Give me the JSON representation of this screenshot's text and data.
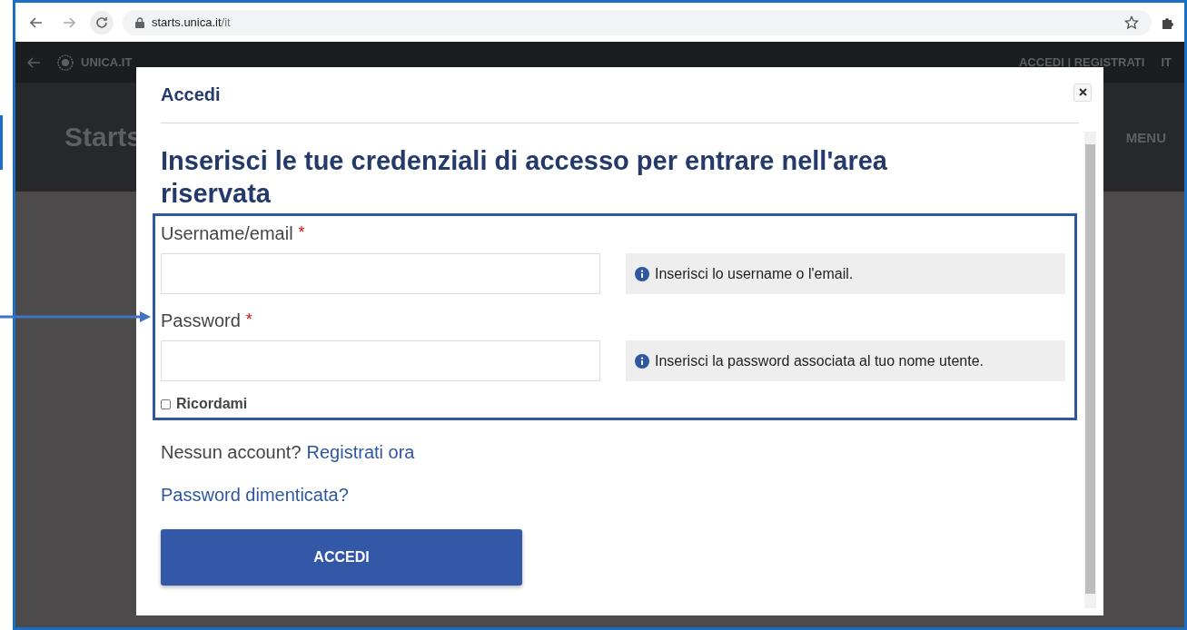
{
  "browser": {
    "url_host": "starts.unica.it",
    "url_path": "/it"
  },
  "site_nav": {
    "brand": "UNICA.IT",
    "account_links": "ACCEDI | REGISTRATI",
    "language": "IT"
  },
  "site_header": {
    "title": "Starts",
    "menu": "MENU"
  },
  "modal": {
    "title": "Accedi",
    "heading": "Inserisci le tue credenziali di accesso per entrare nell'area riservata",
    "fields": [
      {
        "label": "Username/email",
        "required_mark": "*",
        "help": "Inserisci lo username o l'email."
      },
      {
        "label": "Password",
        "required_mark": "*",
        "help": "Inserisci la password associata al tuo nome utente."
      }
    ],
    "remember": {
      "label": "Ricordami",
      "checked": false
    },
    "signup_prompt": "Nessun account?",
    "signup_link": "Registrati ora",
    "forgot_link": "Password dimenticata?",
    "submit": "ACCEDI"
  }
}
